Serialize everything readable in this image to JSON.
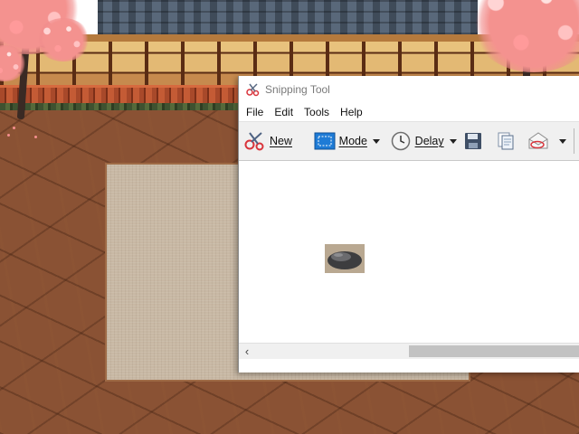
{
  "window": {
    "title": "Snipping Tool",
    "title_color": "#7a7a7a"
  },
  "menu": {
    "items": [
      "File",
      "Edit",
      "Tools",
      "Help"
    ]
  },
  "toolbar": {
    "new_label": "New",
    "mode_label": "Mode",
    "delay_label": "Delay",
    "icons": [
      "scissors-icon",
      "mode-icon",
      "clock-icon",
      "save-icon",
      "copy-icon",
      "send-icon"
    ]
  },
  "canvas": {
    "content": "captured-rock-image"
  },
  "colors": {
    "toolbar_bg": "#f0f0f0",
    "window_bg": "#ffffff",
    "mode_icon_blue": "#1e7bd6"
  }
}
